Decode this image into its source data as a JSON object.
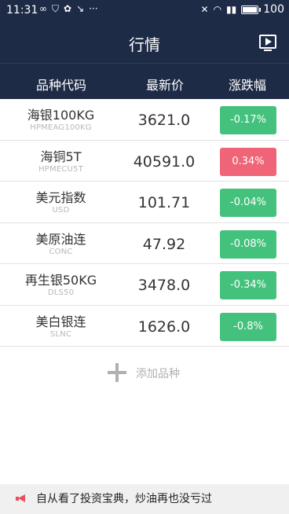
{
  "status_bar": {
    "time": "11:31",
    "battery": "100"
  },
  "header": {
    "title": "行情"
  },
  "columns": {
    "name": "品种代码",
    "price": "最新价",
    "change": "涨跌幅"
  },
  "quotes": [
    {
      "name": "海银100KG",
      "code": "HPMEAG100KG",
      "price": "3621.0",
      "change": "-0.17%",
      "direction": "down"
    },
    {
      "name": "海铜5T",
      "code": "HPMECU5T",
      "price": "40591.0",
      "change": "0.34%",
      "direction": "up"
    },
    {
      "name": "美元指数",
      "code": "USD",
      "price": "101.71",
      "change": "-0.04%",
      "direction": "down"
    },
    {
      "name": "美原油连",
      "code": "CONC",
      "price": "47.92",
      "change": "-0.08%",
      "direction": "down"
    },
    {
      "name": "再生银50KG",
      "code": "DLS50",
      "price": "3478.0",
      "change": "-0.34%",
      "direction": "down"
    },
    {
      "name": "美白银连",
      "code": "SLNC",
      "price": "1626.0",
      "change": "-0.8%",
      "direction": "down"
    }
  ],
  "add_item": {
    "label": "添加品种"
  },
  "marquee": {
    "text": "自从看了投资宝典，炒油再也没亏过"
  },
  "colors": {
    "header_bg": "#1e2b47",
    "down": "#44c27d",
    "up": "#ef6477"
  },
  "icons": [
    "infinity-icon",
    "shield-icon",
    "paw-icon",
    "signal-off-icon",
    "more-dots-icon",
    "mute-icon",
    "wifi-icon",
    "signal-icon",
    "battery-icon",
    "tv-play-icon",
    "plus-icon",
    "megaphone-icon"
  ]
}
